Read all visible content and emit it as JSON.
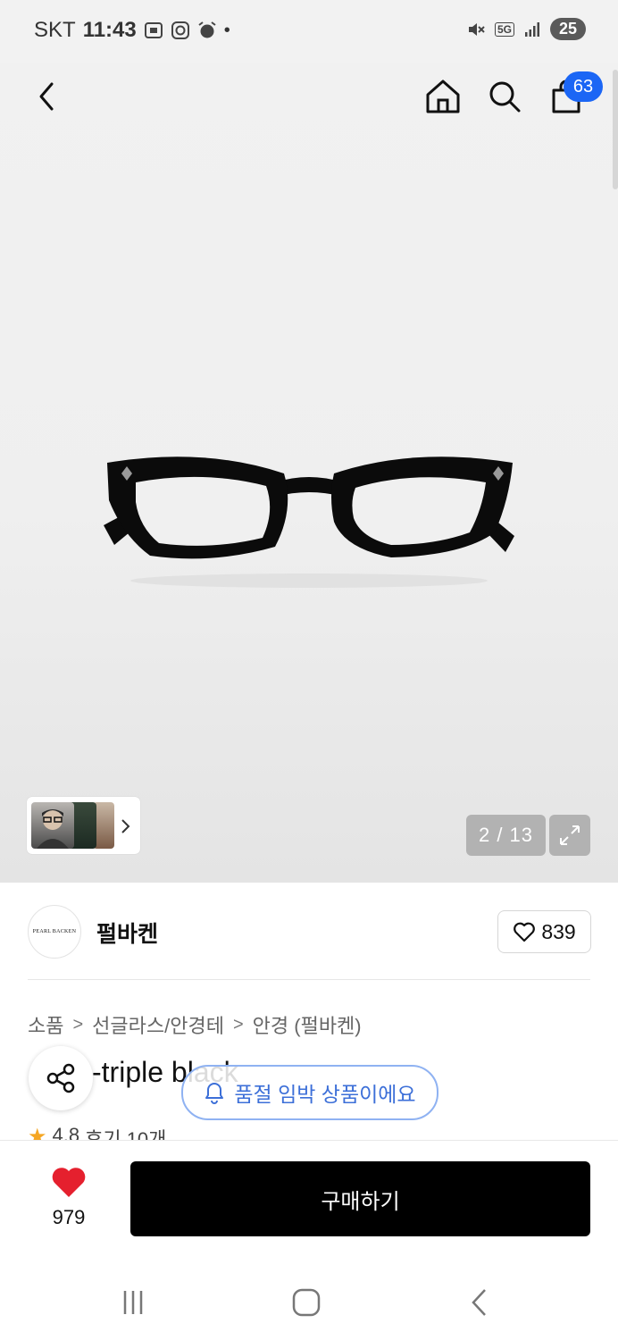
{
  "status_bar": {
    "carrier": "SKT",
    "time": "11:43",
    "network": "5G",
    "battery": "25"
  },
  "nav": {
    "cart_count": "63"
  },
  "gallery": {
    "counter": "2 / 13"
  },
  "brand": {
    "logo_text": "PEARL BACKEN",
    "name": "펄바켄",
    "like_count": "839"
  },
  "breadcrumb": {
    "items": [
      "소품",
      "선글라스/안경테",
      "안경 (펄바켄)"
    ],
    "separator": ">"
  },
  "product": {
    "title_visible": "-triple black",
    "rating": "4.8",
    "reviews": "후기 10개"
  },
  "alert": {
    "text": "품절 임박 상품이에요"
  },
  "bottom": {
    "wish_count": "979",
    "buy_label": "구매하기"
  },
  "colors": {
    "accent": "#1b66f5",
    "heart": "#e5202e",
    "star": "#f5a623",
    "buy_bg": "#000000"
  }
}
